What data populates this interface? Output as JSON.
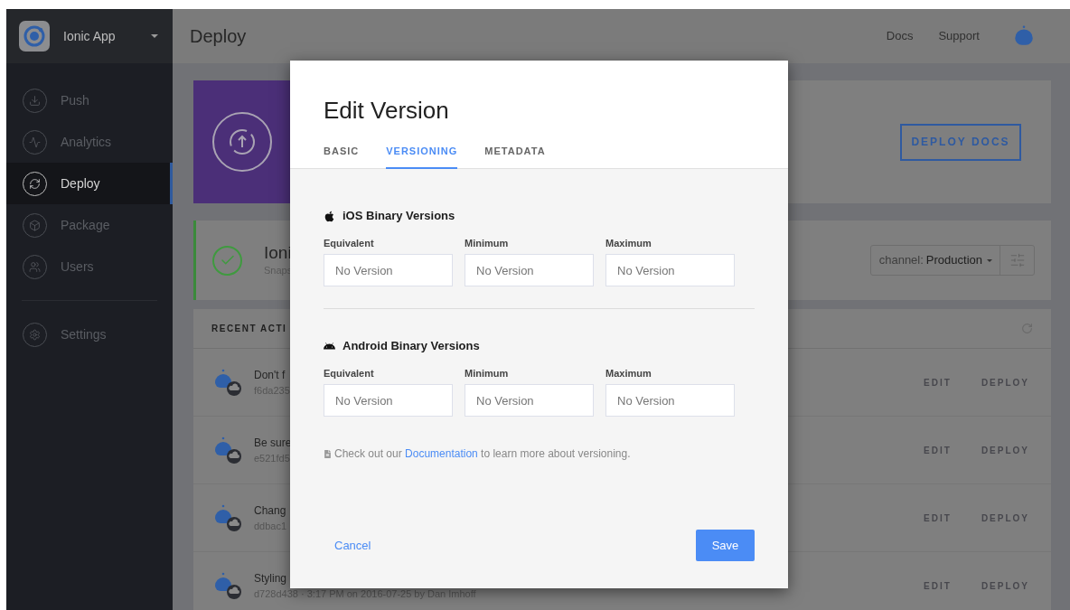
{
  "sidebar": {
    "app_name": "Ionic App",
    "items": [
      {
        "label": "Push",
        "selected": false
      },
      {
        "label": "Analytics",
        "selected": false
      },
      {
        "label": "Deploy",
        "selected": true
      },
      {
        "label": "Package",
        "selected": false
      },
      {
        "label": "Users",
        "selected": false
      }
    ],
    "footer_items": [
      {
        "label": "Settings",
        "selected": false
      }
    ]
  },
  "header": {
    "title": "Deploy",
    "links": [
      "Docs",
      "Support"
    ]
  },
  "hero": {
    "button": "DEPLOY DOCS"
  },
  "status": {
    "title": "Ioni",
    "subtitle": "Snaps",
    "channel_label": "channel:",
    "channel_value": "Production"
  },
  "activity": {
    "heading": "RECENT ACTI",
    "rows": [
      {
        "title": "Don't f",
        "meta": "f6da235",
        "edit": "EDIT",
        "deploy": "DEPLOY"
      },
      {
        "title": "Be sure",
        "meta": "e521fd5",
        "edit": "EDIT",
        "deploy": "DEPLOY"
      },
      {
        "title": "Chang",
        "meta": "ddbac1",
        "edit": "EDIT",
        "deploy": "DEPLOY"
      },
      {
        "title": "Styling",
        "meta": "d728d438 · 3:17 PM on 2016-07-25 by Dan Imhoff",
        "edit": "EDIT",
        "deploy": "DEPLOY"
      }
    ]
  },
  "modal": {
    "title": "Edit Version",
    "tabs": [
      {
        "label": "BASIC",
        "selected": false
      },
      {
        "label": "VERSIONING",
        "selected": true
      },
      {
        "label": "METADATA",
        "selected": false
      }
    ],
    "sections": [
      {
        "heading": "iOS Binary Versions",
        "fields": [
          {
            "label": "Equivalent",
            "placeholder": "No Version"
          },
          {
            "label": "Minimum",
            "placeholder": "No Version"
          },
          {
            "label": "Maximum",
            "placeholder": "No Version"
          }
        ]
      },
      {
        "heading": "Android Binary Versions",
        "fields": [
          {
            "label": "Equivalent",
            "placeholder": "No Version"
          },
          {
            "label": "Minimum",
            "placeholder": "No Version"
          },
          {
            "label": "Maximum",
            "placeholder": "No Version"
          }
        ]
      }
    ],
    "note": "Check out our ",
    "note_link": "Documentation",
    "note_end": " to learn more about versioning.",
    "cancel": "Cancel",
    "save": "Save"
  }
}
